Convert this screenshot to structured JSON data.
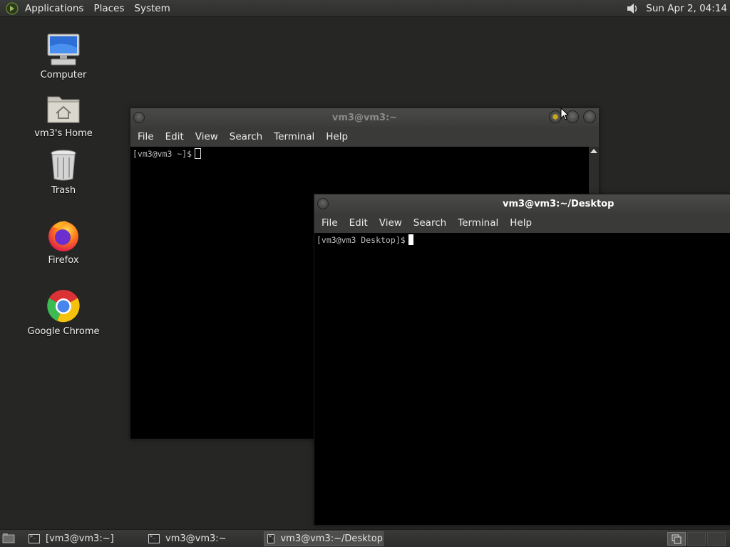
{
  "top_panel": {
    "menus": [
      "Applications",
      "Places",
      "System"
    ],
    "clock": "Sun Apr  2, 04:14"
  },
  "desktop_icons": [
    {
      "label": "Computer",
      "icon": "computer-icon"
    },
    {
      "label": "vm3's Home",
      "icon": "home-folder-icon"
    },
    {
      "label": "Trash",
      "icon": "trash-icon"
    },
    {
      "label": "Firefox",
      "icon": "firefox-icon"
    },
    {
      "label": "Google Chrome",
      "icon": "chrome-icon"
    }
  ],
  "windows": [
    {
      "title": "vm3@vm3:~",
      "menu": [
        "File",
        "Edit",
        "View",
        "Search",
        "Terminal",
        "Help"
      ],
      "prompt": "[vm3@vm3 ~]$"
    },
    {
      "title": "vm3@vm3:~/Desktop",
      "menu": [
        "File",
        "Edit",
        "View",
        "Search",
        "Terminal",
        "Help"
      ],
      "prompt": "[vm3@vm3 Desktop]$"
    }
  ],
  "taskbar": {
    "tasks": [
      "[vm3@vm3:~]",
      "vm3@vm3:~",
      "vm3@vm3:~/Desktop"
    ],
    "active_task": 2
  },
  "colors": {
    "desktop_bg": "#262624",
    "panel_bg": "#333331",
    "terminal_bg": "#000000",
    "active_title_text": "#ffffff",
    "inactive_title_text": "#8a8a88"
  }
}
